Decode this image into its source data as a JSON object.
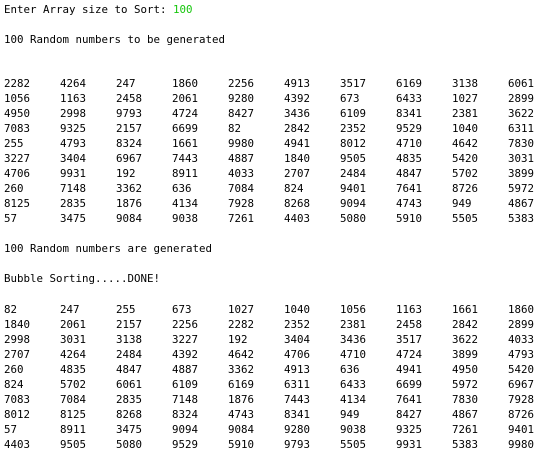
{
  "console": {
    "prompt_label": "Enter Array size to Sort: ",
    "prompt_value": "100",
    "gen_message": "100 Random numbers to be generated",
    "generated_message": "100 Random numbers are generated",
    "sort_message": "Bubble Sorting.....DONE!",
    "input_color": "#16c60c",
    "unsorted_rows": [
      [
        "2282",
        "4264",
        "247",
        "1860",
        "2256",
        "4913",
        "3517",
        "6169",
        "3138",
        "6061"
      ],
      [
        "1056",
        "1163",
        "2458",
        "2061",
        "9280",
        "4392",
        "673",
        "6433",
        "1027",
        "2899"
      ],
      [
        "4950",
        "2998",
        "9793",
        "4724",
        "8427",
        "3436",
        "6109",
        "8341",
        "2381",
        "3622"
      ],
      [
        "7083",
        "9325",
        "2157",
        "6699",
        "82",
        "2842",
        "2352",
        "9529",
        "1040",
        "6311"
      ],
      [
        "255",
        "4793",
        "8324",
        "1661",
        "9980",
        "4941",
        "8012",
        "4710",
        "4642",
        "7830"
      ],
      [
        "3227",
        "3404",
        "6967",
        "7443",
        "4887",
        "1840",
        "9505",
        "4835",
        "5420",
        "3031"
      ],
      [
        "4706",
        "9931",
        "192",
        "8911",
        "4033",
        "2707",
        "2484",
        "4847",
        "5702",
        "3899"
      ],
      [
        "260",
        "7148",
        "3362",
        "636",
        "7084",
        "824",
        "9401",
        "7641",
        "8726",
        "5972"
      ],
      [
        "8125",
        "2835",
        "1876",
        "4134",
        "7928",
        "8268",
        "9094",
        "4743",
        "949",
        "4867"
      ],
      [
        "57",
        "3475",
        "9084",
        "9038",
        "7261",
        "4403",
        "5080",
        "5910",
        "5505",
        "5383"
      ]
    ],
    "sorted_rows": [
      [
        "82",
        "247",
        "255",
        "673",
        "1027",
        "1040",
        "1056",
        "1163",
        "1661",
        "1860"
      ],
      [
        "1840",
        "2061",
        "2157",
        "2256",
        "2282",
        "2352",
        "2381",
        "2458",
        "2842",
        "2899"
      ],
      [
        "2998",
        "3031",
        "3138",
        "3227",
        "192",
        "3404",
        "3436",
        "3517",
        "3622",
        "4033"
      ],
      [
        "2707",
        "4264",
        "2484",
        "4392",
        "4642",
        "4706",
        "4710",
        "4724",
        "3899",
        "4793"
      ],
      [
        "260",
        "4835",
        "4847",
        "4887",
        "3362",
        "4913",
        "636",
        "4941",
        "4950",
        "5420"
      ],
      [
        "824",
        "5702",
        "6061",
        "6109",
        "6169",
        "6311",
        "6433",
        "6699",
        "5972",
        "6967"
      ],
      [
        "7083",
        "7084",
        "2835",
        "7148",
        "1876",
        "7443",
        "4134",
        "7641",
        "7830",
        "7928"
      ],
      [
        "8012",
        "8125",
        "8268",
        "8324",
        "4743",
        "8341",
        "949",
        "8427",
        "4867",
        "8726"
      ],
      [
        "57",
        "8911",
        "3475",
        "9094",
        "9084",
        "9280",
        "9038",
        "9325",
        "7261",
        "9401"
      ],
      [
        "4403",
        "9505",
        "5080",
        "9529",
        "5910",
        "9793",
        "5505",
        "9931",
        "5383",
        "9980"
      ]
    ]
  }
}
